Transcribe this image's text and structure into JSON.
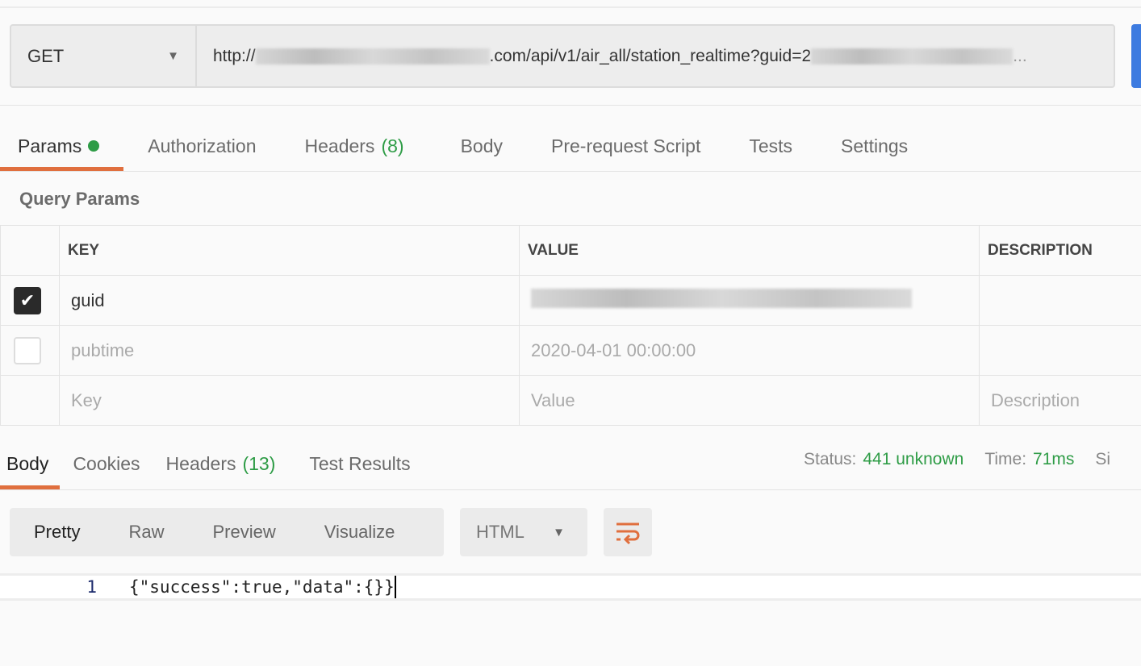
{
  "request": {
    "method": "GET",
    "url_prefix": "http://",
    "url_middle": ".com/api/v1/air_all/station_realtime?guid=2",
    "url_suffix": "..."
  },
  "tabs": [
    {
      "label": "Params"
    },
    {
      "label": "Authorization"
    },
    {
      "label": "Headers",
      "count": "(8)"
    },
    {
      "label": "Body"
    },
    {
      "label": "Pre-request Script"
    },
    {
      "label": "Tests"
    },
    {
      "label": "Settings"
    }
  ],
  "query_params": {
    "title": "Query Params",
    "columns": [
      "KEY",
      "VALUE",
      "DESCRIPTION"
    ],
    "rows": [
      {
        "checked": true,
        "key": "guid",
        "value": ""
      },
      {
        "checked": false,
        "key": "pubtime",
        "value": "2020-04-01 00:00:00"
      }
    ],
    "placeholders": {
      "key": "Key",
      "value": "Value",
      "description": "Description"
    }
  },
  "response": {
    "tabs": [
      {
        "label": "Body"
      },
      {
        "label": "Cookies"
      },
      {
        "label": "Headers",
        "count": "(13)"
      },
      {
        "label": "Test Results"
      }
    ],
    "status_label": "Status:",
    "status": "441 unknown",
    "time_label": "Time:",
    "time": "71ms",
    "size_label": "Si",
    "views": [
      "Pretty",
      "Raw",
      "Preview",
      "Visualize"
    ],
    "format": "HTML",
    "line_number": "1",
    "body": "{\"success\":true,\"data\":{}}"
  },
  "colors": {
    "accent": "#e06f3e",
    "green": "#2e9c46",
    "send": "#3d7be0"
  }
}
